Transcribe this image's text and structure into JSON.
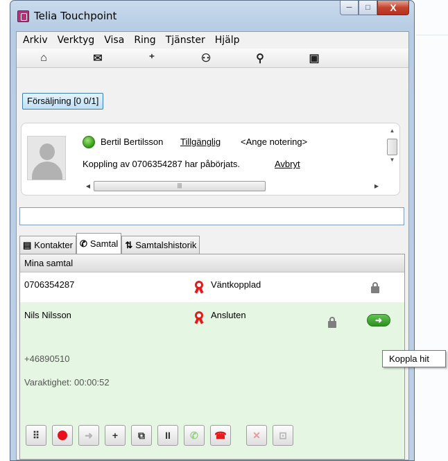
{
  "window": {
    "title": "Telia Touchpoint",
    "min_glyph": "─",
    "max_glyph": "□",
    "close_glyph": "X"
  },
  "menu": [
    "Arkiv",
    "Verktyg",
    "Visa",
    "Ring",
    "Tjänster",
    "Hjälp"
  ],
  "toolbar": {
    "icons": [
      "home-icon",
      "mail-icon",
      "add-contact-icon",
      "group-icon",
      "transfer-network-icon",
      "calendar-icon"
    ],
    "glyphs": [
      "⌂",
      "✉",
      "⁺",
      "⚇",
      "⚲",
      "▣"
    ]
  },
  "queue": {
    "label": "Försäljning [0 0/1]"
  },
  "contact": {
    "name": "Bertil Bertilsson",
    "status": "Tillgänglig",
    "note": "<Ange notering>",
    "transfer_text": "Koppling av 0706354287 har påbörjats.",
    "abort": "Avbryt",
    "presence_color": "#3aa81a"
  },
  "search": {
    "value": ""
  },
  "tabs": [
    {
      "label": "Kontakter",
      "icon": "contacts-icon",
      "glyph": "▤"
    },
    {
      "label": "Samtal",
      "icon": "phone-icon",
      "glyph": "✆"
    },
    {
      "label": "Samtalshistorik",
      "icon": "history-icon",
      "glyph": "⇅"
    }
  ],
  "calls": {
    "header": "Mina samtal",
    "rows": [
      {
        "number": "0706354287",
        "state": "Väntkopplad"
      },
      {
        "name": "Nils Nilsson",
        "state": "Ansluten",
        "phone": "+46890510",
        "duration": "Varaktighet: 00:00:52"
      }
    ]
  },
  "actions": {
    "glyphs": [
      "⠿",
      "",
      "➜",
      "+",
      "⧉",
      "II",
      "✆",
      "☎",
      "✕",
      "⊡"
    ]
  },
  "tooltip": {
    "text": "Koppla hit"
  },
  "colors": {
    "active_call_bg": "#e5f7e3",
    "record": "#e8101a",
    "hangup": "#e21c1c",
    "accent": "#3c7fb1"
  }
}
